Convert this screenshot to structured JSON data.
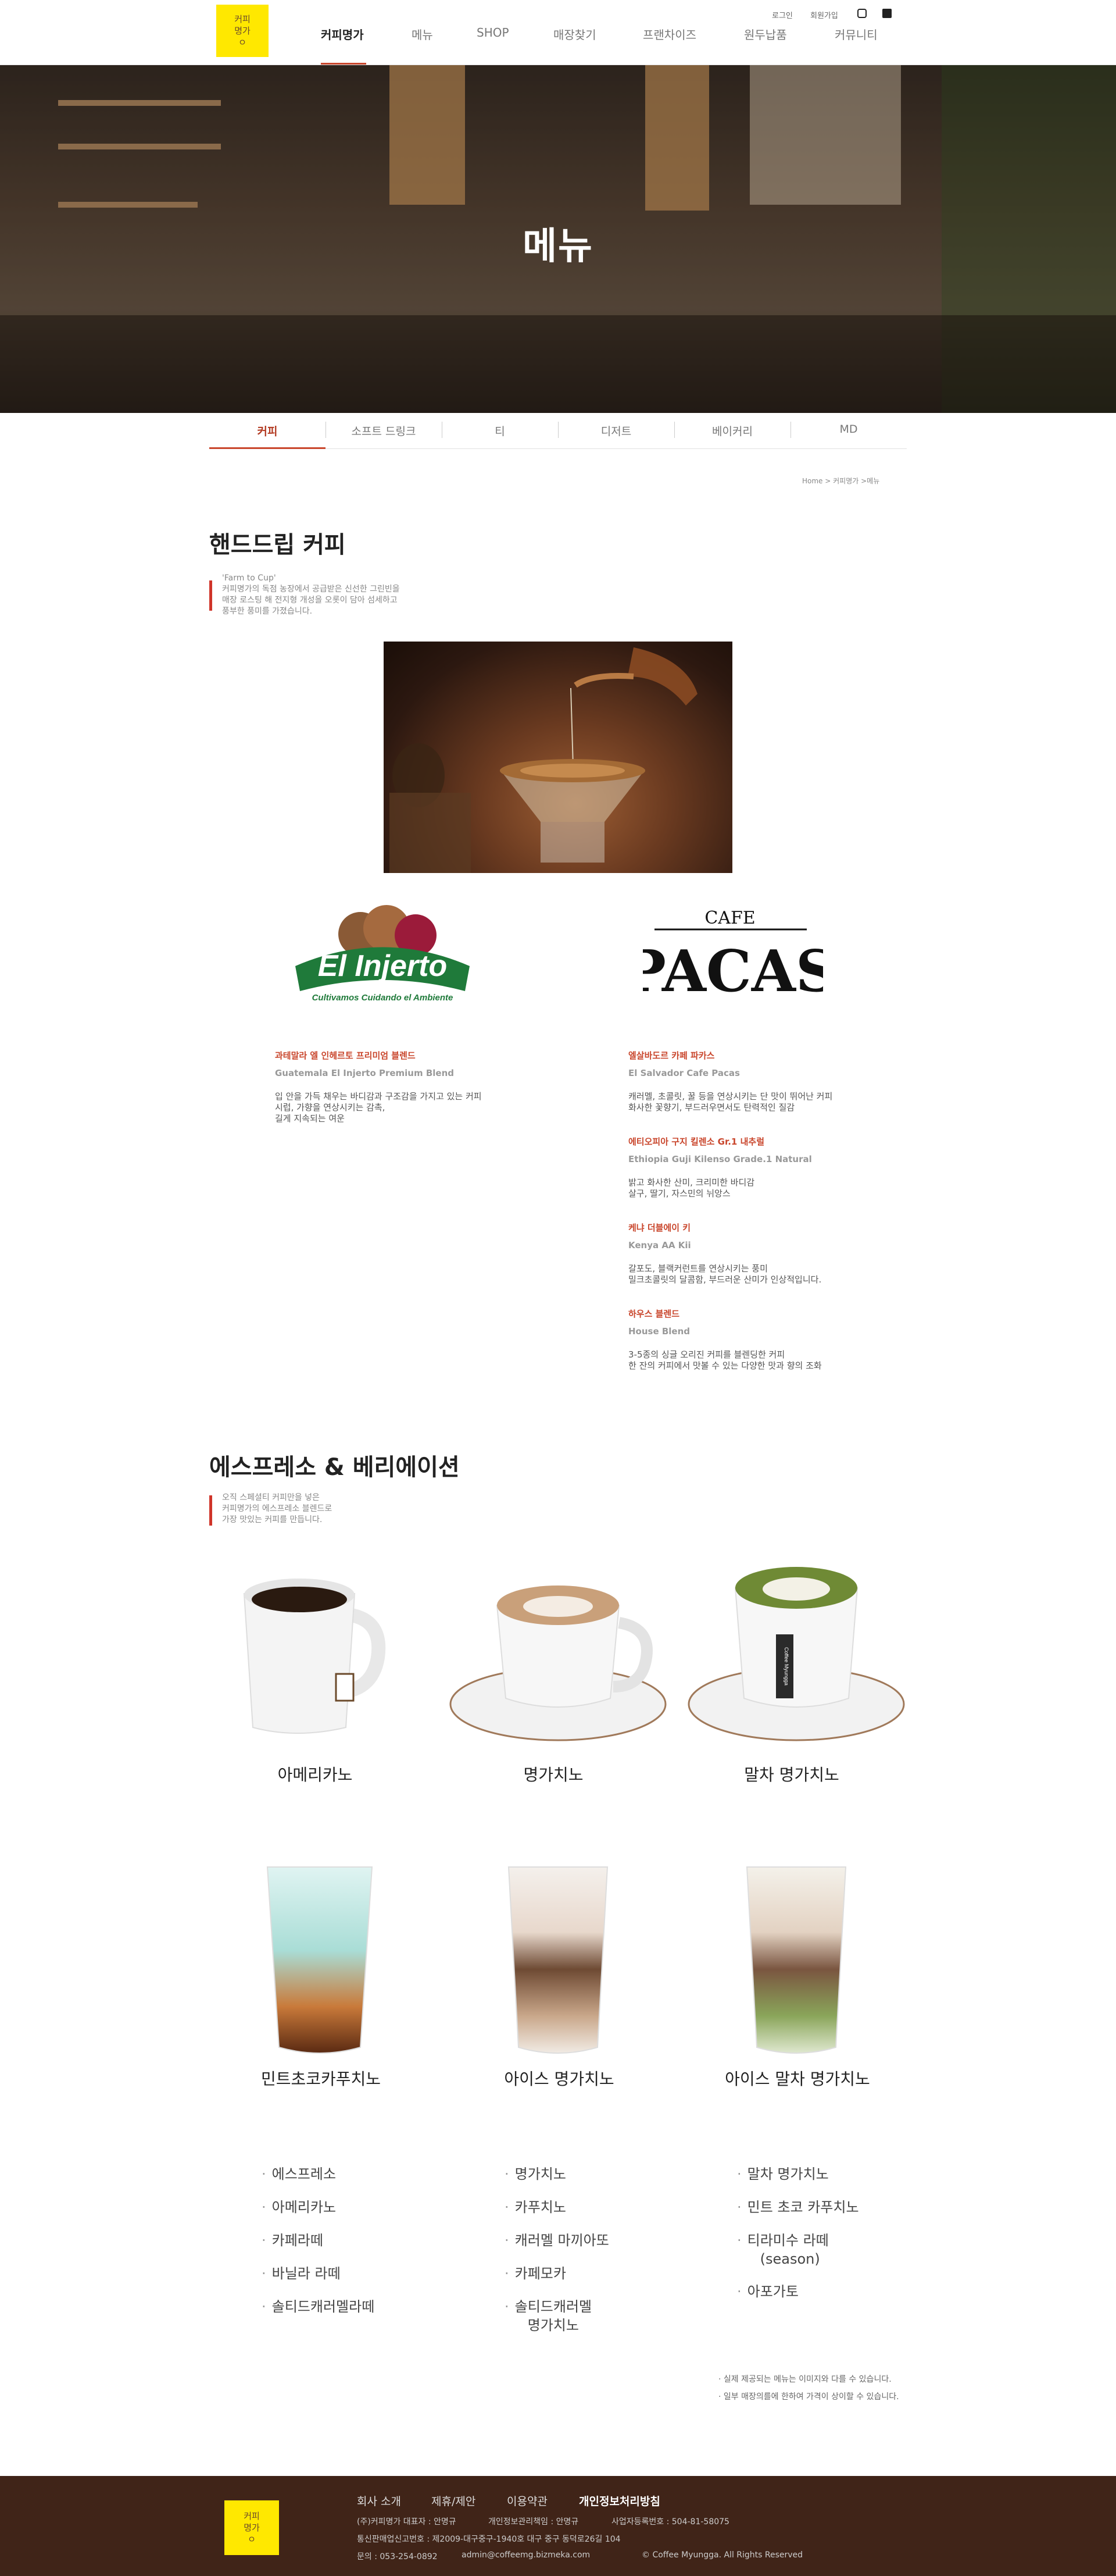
{
  "header": {
    "logo_text": [
      "커피",
      "명가",
      "ㅇ"
    ],
    "nav": [
      "커피명가",
      "메뉴",
      "SHOP",
      "매장찾기",
      "프랜차이즈",
      "원두납품",
      "커뮤니티"
    ],
    "util": {
      "login": "로그인",
      "join": "회원가입"
    }
  },
  "hero": {
    "title": "메뉴"
  },
  "submenu": [
    "커피",
    "소프트 드링크",
    "티",
    "디저트",
    "베이커리",
    "MD"
  ],
  "breadcrumb": "Home > 커피명가 >메뉴",
  "handdrip": {
    "title": "핸드드립 커피",
    "desc_lines": [
      "'Farm to Cup'",
      "커피명가의 독점 농장에서 공급받은 신선한 그린빈을",
      "매장 로스팅 해 전지형 개성을 오롯이 담아 섬세하고",
      "풍부한 풍미를 가졌습니다."
    ],
    "logo_el_injerto": {
      "name": "El Injerto",
      "sub": "Cultivamos Cuidando el Ambiente"
    },
    "logo_pacas": {
      "top": "CAFE",
      "name": "PACAS"
    },
    "left_brands": [
      {
        "name_ko": "과테말라 엘 인헤르토 프리미엄 블렌드",
        "name_en": "Guatemala El Injerto Premium Blend",
        "desc": [
          "입 안을 가득 채우는 바디감과 구조감을 가지고 있는 커피",
          "시럽, 가향을 연상시키는 감촉,",
          "길게 지속되는 여운"
        ]
      }
    ],
    "right_brands": [
      {
        "name_ko": "엘살바도르 카페 파카스",
        "name_en": "El Salvador Cafe Pacas",
        "desc": [
          "캐러멜, 초콜릿, 꿀 등을 연상시키는 단 맛이 뛰어난 커피",
          "화사한 꽃향기, 부드러우면서도 탄력적인 질감"
        ]
      },
      {
        "name_ko": "에티오피아 구지 킬렌소 Gr.1 내추럴",
        "name_en": "Ethiopia Guji Kilenso Grade.1 Natural",
        "desc": [
          "밝고 화사한 산미, 크리미한 바디감",
          "살구, 딸기, 자스민의 뉘앙스"
        ]
      },
      {
        "name_ko": "케냐 더블에이 키",
        "name_en": "Kenya AA Kii",
        "desc": [
          "갈포도, 블랙커런트를 연상시키는 풍미",
          "밀크초콜릿의 달콤함, 부드러운 산미가 인상적입니다."
        ]
      },
      {
        "name_ko": "하우스 블렌드",
        "name_en": "House Blend",
        "desc": [
          "3-5종의 싱글 오리진 커피를 블렌딩한 커피",
          "한 잔의 커피에서 맛볼 수 있는 다양한 맛과 향의 조화"
        ]
      }
    ]
  },
  "espresso": {
    "title": "에스프레소 & 베리에이션",
    "desc_lines": [
      "오직 스페셜티 커피만을 넣은",
      "커피명가의 에스프레소 블렌드로",
      "가장 맛있는 커피를 만듭니다."
    ],
    "cups": [
      "아메리카노",
      "명가치노",
      "말차 명가치노",
      "민트초코카푸치노",
      "아이스 명가치노",
      "아이스 말차 명가치노"
    ],
    "cup_badge": "Coffee Myungga",
    "menu_col1": [
      "에스프레소",
      "아메리카노",
      "카페라떼",
      "바닐라 라떼",
      "솔티드캐러멜라떼"
    ],
    "menu_col2": [
      "명가치노",
      "카푸치노",
      "캐러멜 마끼아또",
      "카페모카",
      "솔티드캐러멜|명가치노"
    ],
    "menu_col3": [
      "말차 명가치노",
      "민트 초코 카푸치노",
      "티라미수 라떼|(season)",
      "아포가토"
    ],
    "notes": [
      "· 실제 제공되는 메뉴는 이미지와 다를 수 있습니다.",
      "· 일부 매장의를에 한하여 가격이 상이할 수 있습니다."
    ]
  },
  "footer": {
    "links": [
      "회사 소개",
      "제휴/제안",
      "이용약관",
      "개인정보처리방침"
    ],
    "info1": [
      "(주)커피명가 대표자 : 안명규",
      "개인정보관리책임 : 안명규",
      "사업자등록번호 : 504-81-58075"
    ],
    "info2": "통신판매업신고번호 : 제2009-대구중구-1940호 대구 중구 동덕로26길 104",
    "info3": [
      "문의 : 053-254-0892",
      "admin@coffeemg.bizmeka.com",
      "© Coffee Myungga. All Rights Reserved"
    ]
  },
  "colors": {
    "accent": "#c9462c",
    "logo_yellow": "#ffe800",
    "footer_bg": "#402418"
  }
}
